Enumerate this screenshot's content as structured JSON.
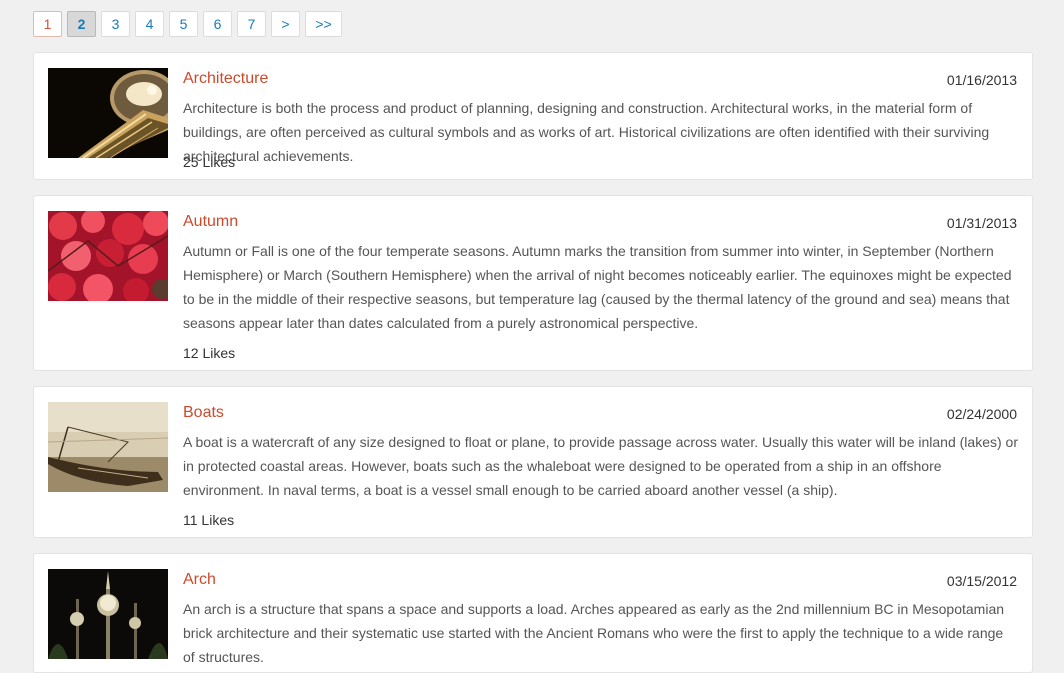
{
  "pagination": {
    "pages": [
      "1",
      "2",
      "3",
      "4",
      "5",
      "6",
      "7"
    ],
    "current": "2",
    "next_label": ">",
    "last_label": ">>"
  },
  "articles": [
    {
      "title": "Architecture",
      "date": "01/16/2013",
      "description": "Architecture is both the process and product of planning, designing and construction. Architectural works, in the material form of buildings, are often perceived as cultural symbols and as works of art. Historical civilizations are often identified with their surviving architectural achievements.",
      "likes": "25 Likes"
    },
    {
      "title": "Autumn",
      "date": "01/31/2013",
      "description": "Autumn or Fall is one of the four temperate seasons. Autumn marks the transition from summer into winter, in September (Northern Hemisphere) or March (Southern Hemisphere) when the arrival of night becomes noticeably earlier. The equinoxes might be expected to be in the middle of their respective seasons, but temperature lag (caused by the thermal latency of the ground and sea) means that seasons appear later than dates calculated from a purely astronomical perspective.",
      "likes": "12 Likes"
    },
    {
      "title": "Boats",
      "date": "02/24/2000",
      "description": "A boat is a watercraft of any size designed to float or plane, to provide passage across water. Usually this water will be inland (lakes) or in protected coastal areas. However, boats such as the whaleboat were designed to be operated from a ship in an offshore environment. In naval terms, a boat is a vessel small enough to be carried aboard another vessel (a ship).",
      "likes": "11 Likes"
    },
    {
      "title": "Arch",
      "date": "03/15/2012",
      "description": "An arch is a structure that spans a space and supports a load. Arches appeared as early as the 2nd millennium BC in Mesopotamian brick architecture and their systematic use started with the Ancient Romans who were the first to apply the technique to a wide range of structures.",
      "likes": ""
    }
  ]
}
